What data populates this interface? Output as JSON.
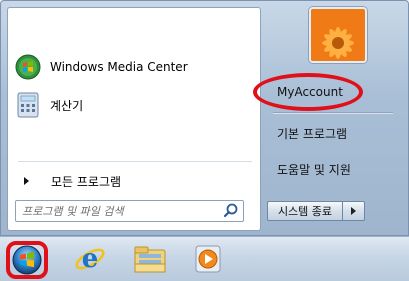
{
  "start_menu": {
    "pinned_programs": [
      {
        "label": "Windows Media Center",
        "icon": "windows-media-center-icon"
      },
      {
        "label": "계산기",
        "icon": "calculator-icon"
      }
    ],
    "all_programs_label": "모든 프로그램",
    "search": {
      "placeholder": "프로그램 및 파일 검색",
      "value": ""
    },
    "user_tile_icon": "flower-user-picture",
    "right_items": [
      {
        "label": "MyAccount"
      },
      {
        "label": "기본 프로그램"
      },
      {
        "label": "도움말 및 지원"
      }
    ],
    "shutdown_label": "시스템 종료"
  },
  "taskbar": {
    "start_button_icon": "windows-orb-icon",
    "pinned": [
      {
        "name": "internet-explorer-icon"
      },
      {
        "name": "windows-explorer-icon"
      },
      {
        "name": "windows-media-player-icon"
      }
    ]
  },
  "colors": {
    "highlight_red": "#e0101a",
    "menu_glass": "#a9bfd6",
    "left_pane": "#ffffff"
  }
}
